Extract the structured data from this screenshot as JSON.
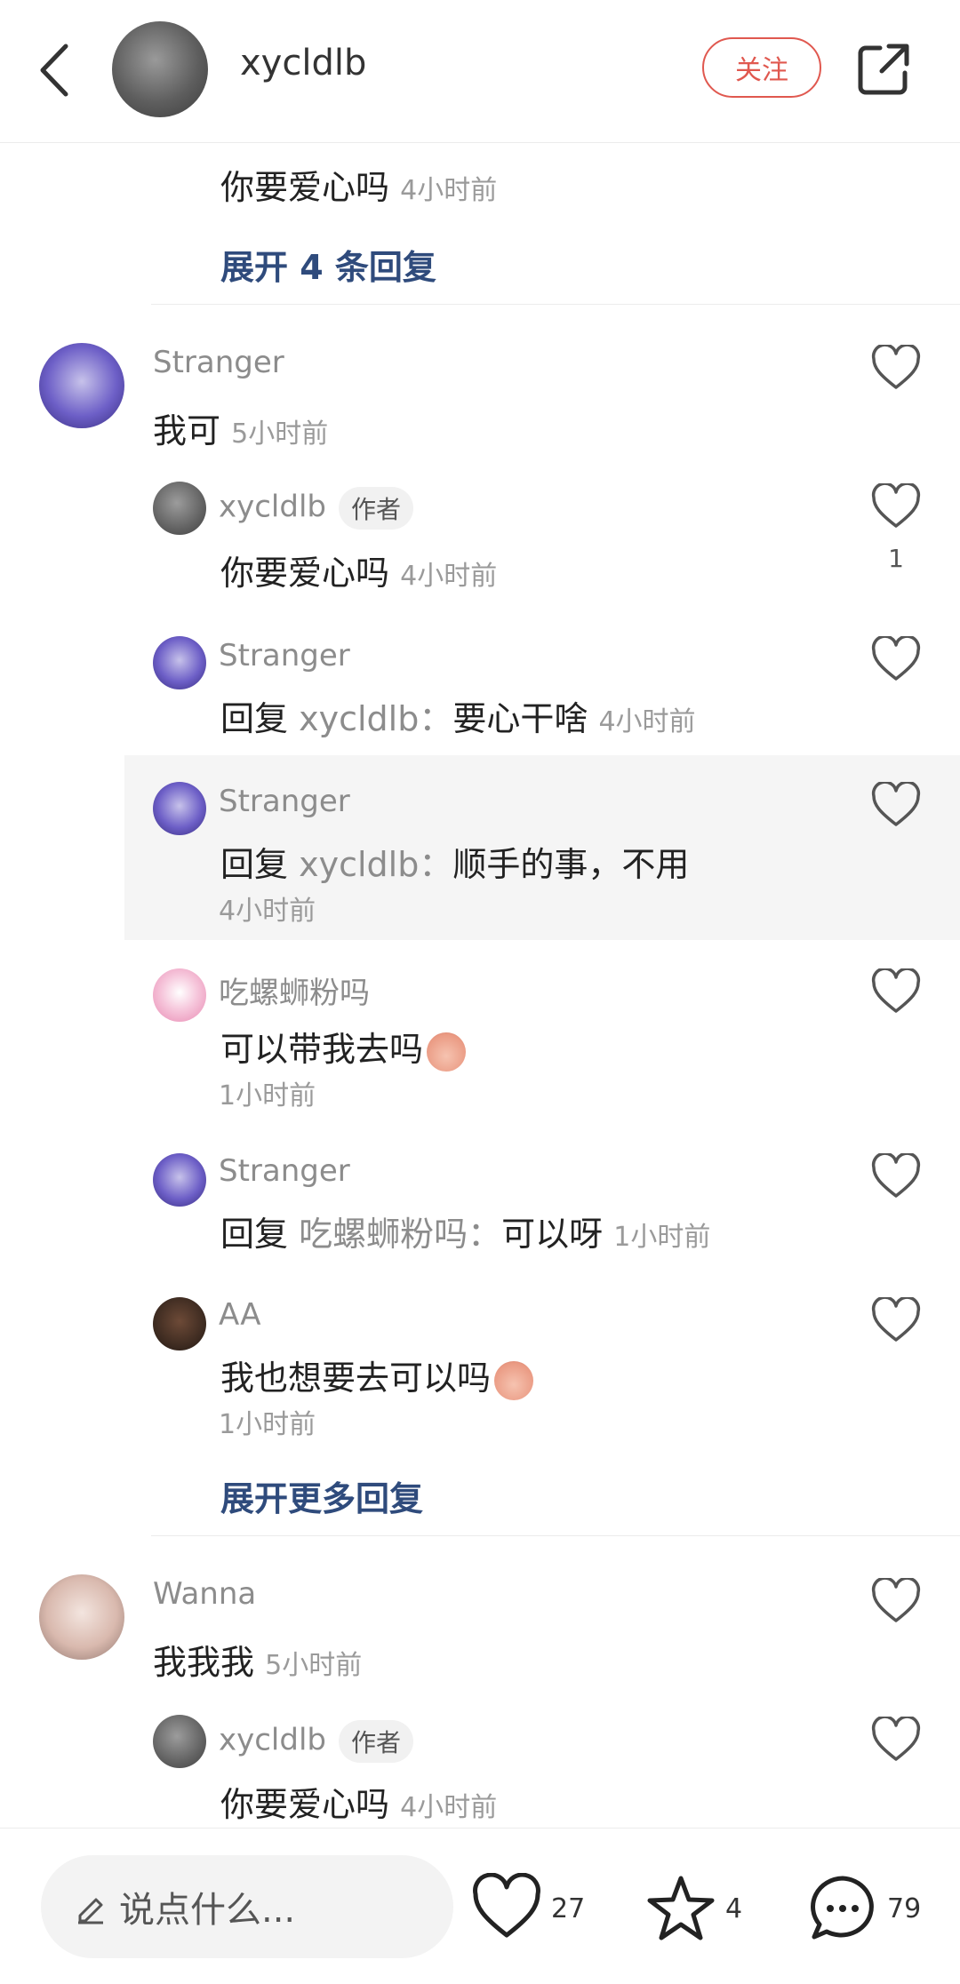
{
  "header": {
    "username": "xycldlb",
    "follow_label": "关注",
    "icons": [
      "back-arrow-icon",
      "share-icon"
    ]
  },
  "top_partial": {
    "text": "你要爱心吗",
    "time": "4小时前",
    "expand_label": "展开 4 条回复"
  },
  "thread1": {
    "user": "Stranger",
    "text": "我可",
    "time": "5小时前",
    "replies": [
      {
        "user": "xycldlb",
        "tag": "作者",
        "text": "你要爱心吗",
        "time": "4小时前",
        "likes": "1"
      },
      {
        "user": "Stranger",
        "reply_prefix": "回复",
        "reply_to": "xycldlb：",
        "text": "要心干啥",
        "time": "4小时前"
      },
      {
        "user": "Stranger",
        "reply_prefix": "回复",
        "reply_to": "xycldlb：",
        "text": "顺手的事，不用",
        "time": "4小时前"
      },
      {
        "user": "吃螺蛳粉吗",
        "text": "可以带我去吗",
        "time": "1小时前"
      },
      {
        "user": "Stranger",
        "reply_prefix": "回复",
        "reply_to": "吃螺蛳粉吗：",
        "text": "可以呀",
        "time": "1小时前"
      },
      {
        "user": "AA",
        "text": "我也想要去可以吗",
        "time": "1小时前"
      }
    ],
    "expand_label": "展开更多回复"
  },
  "thread2": {
    "user": "Wanna",
    "text": "我我我",
    "time": "5小时前",
    "replies": [
      {
        "user": "xycldlb",
        "tag": "作者",
        "text": "你要爱心吗",
        "time": "4小时前"
      }
    ]
  },
  "bottom_bar": {
    "input_placeholder": "说点什么...",
    "likes_count": "27",
    "favorites_count": "4",
    "comments_count": "79"
  },
  "colors": {
    "accent_red": "#e0584f",
    "expand_blue": "#2f4b7c",
    "muted_text": "#8c8c8c"
  }
}
